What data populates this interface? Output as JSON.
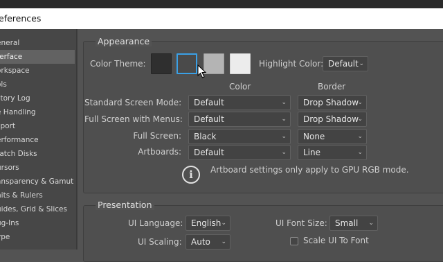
{
  "window": {
    "title": "eferences"
  },
  "sidebar": {
    "items": [
      {
        "label": "eneral"
      },
      {
        "label": "terface"
      },
      {
        "label": "orkspace"
      },
      {
        "label": "ols"
      },
      {
        "label": "story Log"
      },
      {
        "label": "e Handling"
      },
      {
        "label": "sport"
      },
      {
        "label": "erformance"
      },
      {
        "label": "ratch Disks"
      },
      {
        "label": "ursors"
      },
      {
        "label": "ansparency & Gamut"
      },
      {
        "label": "nits & Rulers"
      },
      {
        "label": "uides, Grid & Slices"
      },
      {
        "label": "ug-Ins"
      },
      {
        "label": "ype"
      }
    ]
  },
  "appearance": {
    "title": "Appearance",
    "color_theme_label": "Color Theme:",
    "theme_colors": [
      "#2f2f2f",
      "#4a4a4a",
      "#b4b4b4",
      "#ececec"
    ],
    "selected_theme_border": "#3aa0e6",
    "highlight_label": "Highlight Color:",
    "highlight_value": "Default",
    "col_color": "Color",
    "col_border": "Border",
    "rows": [
      {
        "label": "Standard Screen Mode:",
        "color": "Default",
        "border": "Drop Shadow"
      },
      {
        "label": "Full Screen with Menus:",
        "color": "Default",
        "border": "Drop Shadow"
      },
      {
        "label": "Full Screen:",
        "color": "Black",
        "border": "None"
      },
      {
        "label": "Artboards:",
        "color": "Default",
        "border": "Line"
      }
    ],
    "info_text": "Artboard settings only apply to GPU RGB mode."
  },
  "presentation": {
    "title": "Presentation",
    "ui_language_label": "UI Language:",
    "ui_language_value": "English",
    "ui_font_size_label": "UI Font Size:",
    "ui_font_size_value": "Small",
    "ui_scaling_label": "UI Scaling:",
    "ui_scaling_value": "Auto",
    "scale_font_label": "Scale UI To Font"
  }
}
